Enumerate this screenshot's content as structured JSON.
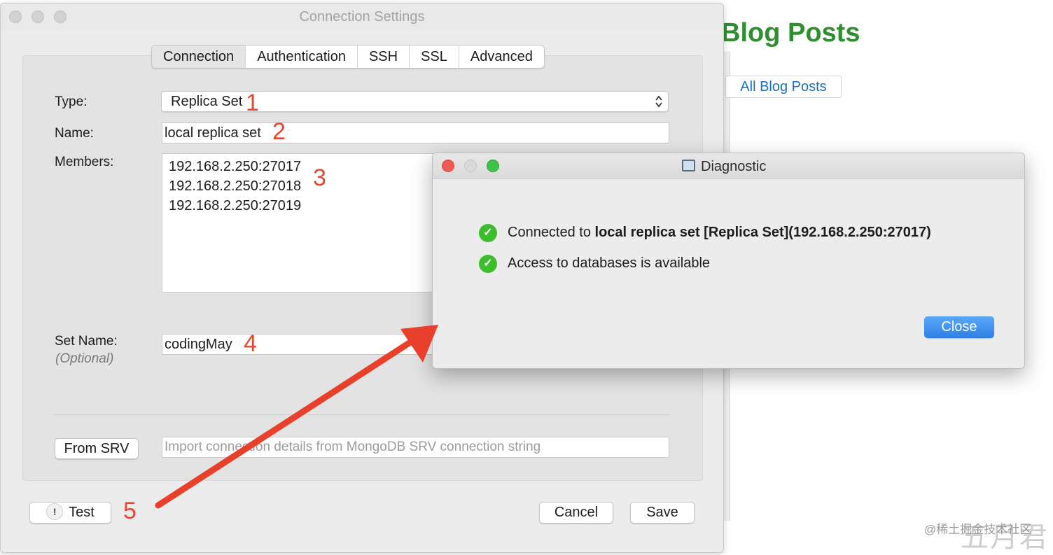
{
  "background": {
    "page_title": "Blog Posts",
    "link_button": "All Blog Posts",
    "watermark_small": "@稀土掘金技术社区",
    "watermark_large": "五月君"
  },
  "window": {
    "title": "Connection Settings"
  },
  "tabs": [
    {
      "label": "Connection",
      "active": true
    },
    {
      "label": "Authentication",
      "active": false
    },
    {
      "label": "SSH",
      "active": false
    },
    {
      "label": "SSL",
      "active": false
    },
    {
      "label": "Advanced",
      "active": false
    }
  ],
  "form": {
    "type_label": "Type:",
    "type_value": "Replica Set",
    "name_label": "Name:",
    "name_value": "local replica set",
    "members_label": "Members:",
    "members": [
      "192.168.2.250:27017",
      "192.168.2.250:27018",
      "192.168.2.250:27019"
    ],
    "setname_label": "Set Name:",
    "setname_optional": "(Optional)",
    "setname_value": "codingMay",
    "from_srv_button": "From SRV",
    "srv_placeholder": "Import connection details from MongoDB SRV connection string"
  },
  "buttons": {
    "test": "Test",
    "cancel": "Cancel",
    "save": "Save"
  },
  "annotations": [
    "1",
    "2",
    "3",
    "4",
    "5"
  ],
  "colors": {
    "annotation": "#e04a32",
    "page_title": "#2f8f2f",
    "link": "#1a6fc4",
    "success": "#3ebd2c",
    "primary_button": "#2f7fe9"
  },
  "dialog": {
    "title": "Diagnostic",
    "line1_prefix": "Connected to ",
    "line1_bold": "local replica set [Replica Set](192.168.2.250:27017)",
    "line2": "Access to databases is available",
    "close_button": "Close",
    "icons": {
      "title": "monitor-icon",
      "status": "check-circle-icon"
    }
  }
}
